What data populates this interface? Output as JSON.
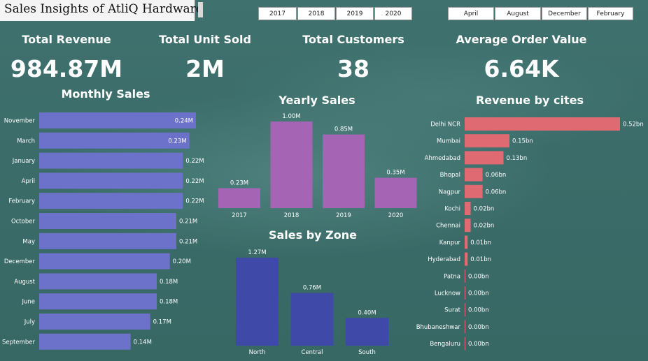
{
  "header": {
    "title": "Sales Insights of AtliQ Hardware"
  },
  "slicers": {
    "years": [
      "2017",
      "2018",
      "2019",
      "2020"
    ],
    "months": [
      "April",
      "August",
      "December",
      "February"
    ]
  },
  "kpis": {
    "total_revenue": {
      "label": "Total Revenue",
      "value": "984.87M"
    },
    "total_unit_sold": {
      "label": "Total Unit Sold",
      "value": "2M"
    },
    "total_customers": {
      "label": "Total Customers",
      "value": "38"
    },
    "avg_order_value": {
      "label": "Average Order Value",
      "value": "6.64K"
    }
  },
  "chart_data": [
    {
      "type": "bar",
      "orientation": "horizontal",
      "title": "Monthly Sales",
      "categories": [
        "November",
        "March",
        "January",
        "April",
        "February",
        "October",
        "May",
        "December",
        "August",
        "June",
        "July",
        "September"
      ],
      "values": [
        0.24,
        0.23,
        0.22,
        0.22,
        0.22,
        0.21,
        0.21,
        0.2,
        0.18,
        0.18,
        0.17,
        0.14
      ],
      "labels": [
        "0.24M",
        "0.23M",
        "0.22M",
        "0.22M",
        "0.22M",
        "0.21M",
        "0.21M",
        "0.20M",
        "0.18M",
        "0.18M",
        "0.17M",
        "0.14M"
      ],
      "color": "#6c72c9",
      "xlim": [
        0,
        0.24
      ]
    },
    {
      "type": "bar",
      "title": "Yearly Sales",
      "categories": [
        "2017",
        "2018",
        "2019",
        "2020"
      ],
      "values": [
        0.23,
        1.0,
        0.85,
        0.35
      ],
      "labels": [
        "0.23M",
        "1.00M",
        "0.85M",
        "0.35M"
      ],
      "color": "#a665b4",
      "ylim": [
        0,
        1.0
      ]
    },
    {
      "type": "bar",
      "title": "Sales by Zone",
      "categories": [
        "North",
        "Central",
        "South"
      ],
      "values": [
        1.27,
        0.76,
        0.4
      ],
      "labels": [
        "1.27M",
        "0.76M",
        "0.40M"
      ],
      "color": "#3e49a8",
      "ylim": [
        0,
        1.27
      ]
    },
    {
      "type": "bar",
      "orientation": "horizontal",
      "title": "Revenue by cites",
      "categories": [
        "Delhi NCR",
        "Mumbai",
        "Ahmedabad",
        "Bhopal",
        "Nagpur",
        "Kochi",
        "Chennai",
        "Kanpur",
        "Hyderabad",
        "Patna",
        "Lucknow",
        "Surat",
        "Bhubaneshwar",
        "Bengaluru"
      ],
      "values": [
        0.52,
        0.15,
        0.13,
        0.06,
        0.06,
        0.02,
        0.02,
        0.01,
        0.01,
        0.0,
        0.0,
        0.0,
        0.0,
        0.0
      ],
      "labels": [
        "0.52bn",
        "0.15bn",
        "0.13bn",
        "0.06bn",
        "0.06bn",
        "0.02bn",
        "0.02bn",
        "0.01bn",
        "0.01bn",
        "0.00bn",
        "0.00bn",
        "0.00bn",
        "0.00bn",
        "0.00bn"
      ],
      "color": "#e06a72",
      "xlim": [
        0,
        0.52
      ]
    }
  ]
}
